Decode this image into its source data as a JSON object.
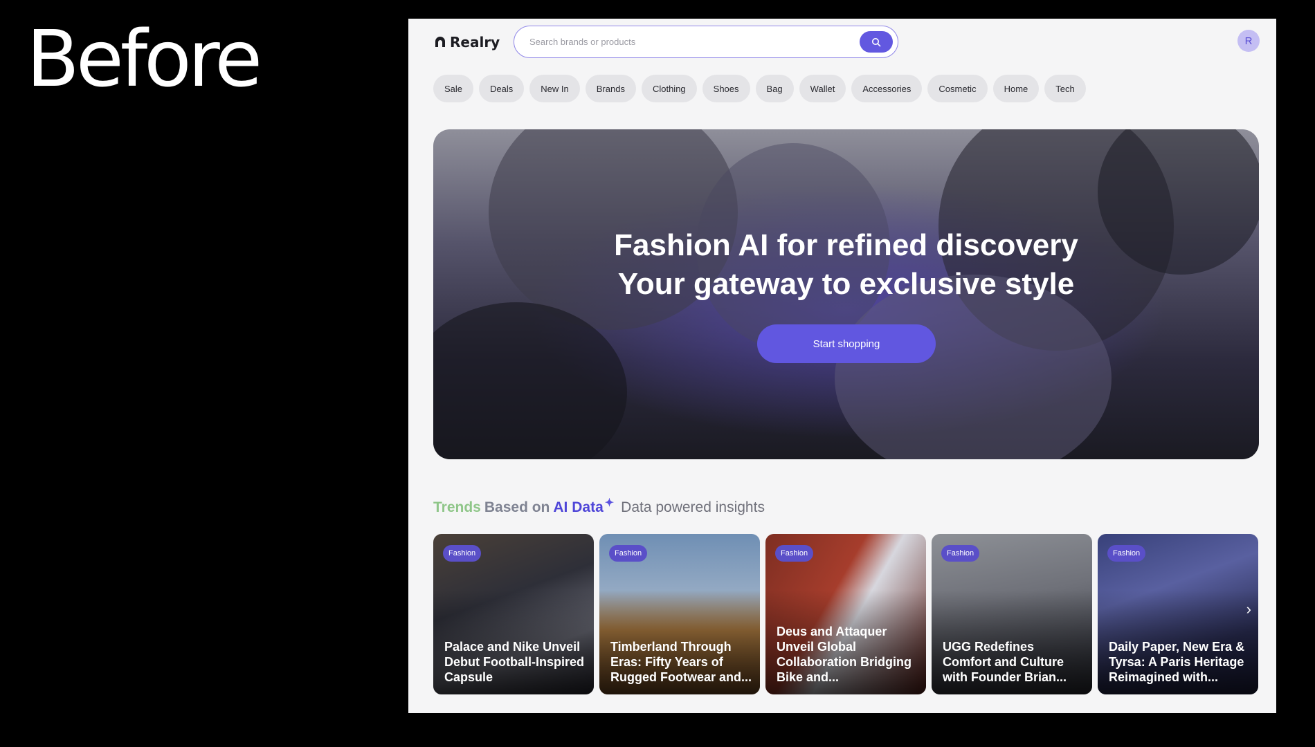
{
  "overlay_label": "Before",
  "app": {
    "brand": "Realry",
    "avatar_initial": "R",
    "accent_color": "#6157e0"
  },
  "search": {
    "placeholder": "Search brands or products",
    "icon": "search-icon"
  },
  "nav": {
    "items": [
      "Sale",
      "Deals",
      "New In",
      "Brands",
      "Clothing",
      "Shoes",
      "Bag",
      "Wallet",
      "Accessories",
      "Cosmetic",
      "Home",
      "Tech"
    ]
  },
  "hero": {
    "line1": "Fashion AI for refined discovery",
    "line2": "Your gateway to exclusive style",
    "cta": "Start shopping"
  },
  "trends": {
    "title_word1": "Trends",
    "title_word2": "Based on",
    "title_word3": "AI Data",
    "subtitle": "Data powered insights",
    "cards": [
      {
        "badge": "Fashion",
        "title": "Palace and Nike Unveil Debut Football-Inspired Capsule"
      },
      {
        "badge": "Fashion",
        "title": "Timberland Through Eras: Fifty Years of Rugged Footwear and..."
      },
      {
        "badge": "Fashion",
        "title": "Deus and Attaquer Unveil Global Collaboration Bridging Bike and..."
      },
      {
        "badge": "Fashion",
        "title": "UGG Redefines Comfort and Culture with Founder Brian..."
      },
      {
        "badge": "Fashion",
        "title": "Daily Paper, New Era & Tyrsa: A Paris Heritage Reimagined with..."
      }
    ]
  }
}
